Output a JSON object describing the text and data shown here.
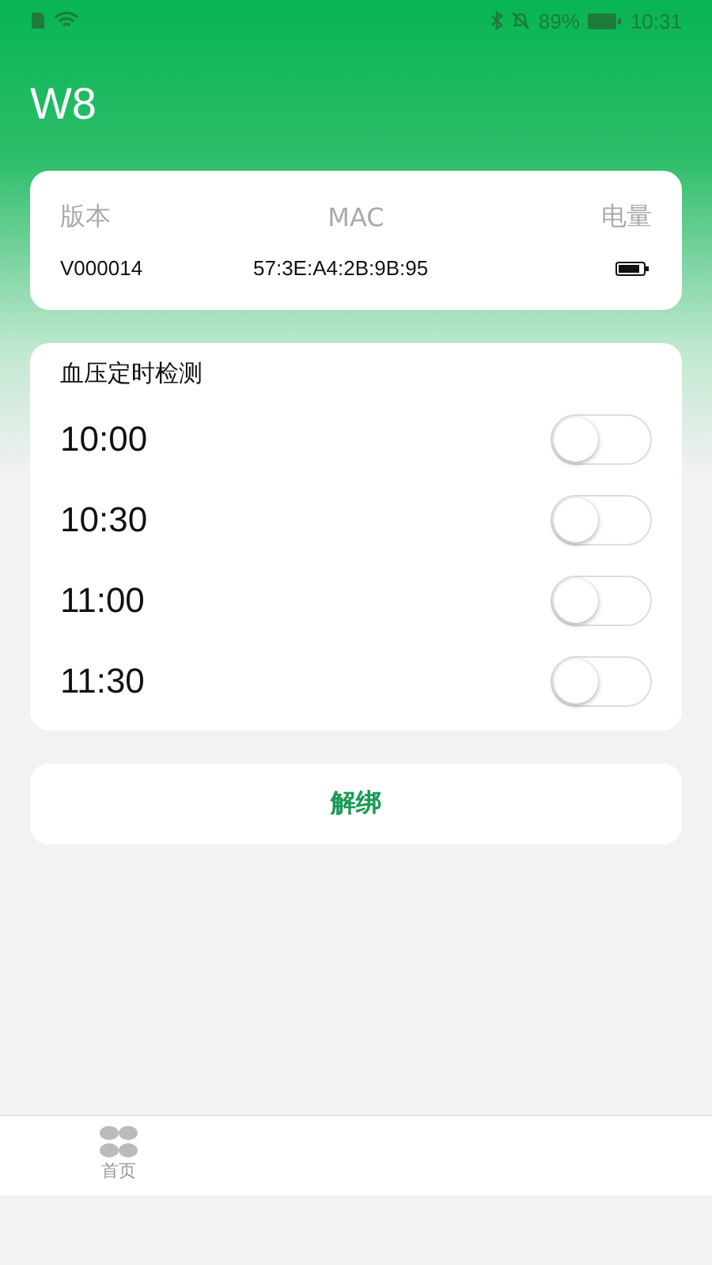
{
  "status_bar": {
    "battery": "89%",
    "time": "10:31"
  },
  "title": "W8",
  "device": {
    "headers": [
      "版本",
      "MAC",
      "电量"
    ],
    "version": "V000014",
    "mac": "57:3E:A4:2B:9B:95"
  },
  "schedule": {
    "title": "血压定时检测",
    "items": [
      {
        "time": "10:00",
        "on": false
      },
      {
        "time": "10:30",
        "on": false
      },
      {
        "time": "11:00",
        "on": false
      },
      {
        "time": "11:30",
        "on": false
      }
    ]
  },
  "unbind_button": "解绑",
  "tabs": [
    {
      "label": "首页",
      "selected": false
    }
  ]
}
